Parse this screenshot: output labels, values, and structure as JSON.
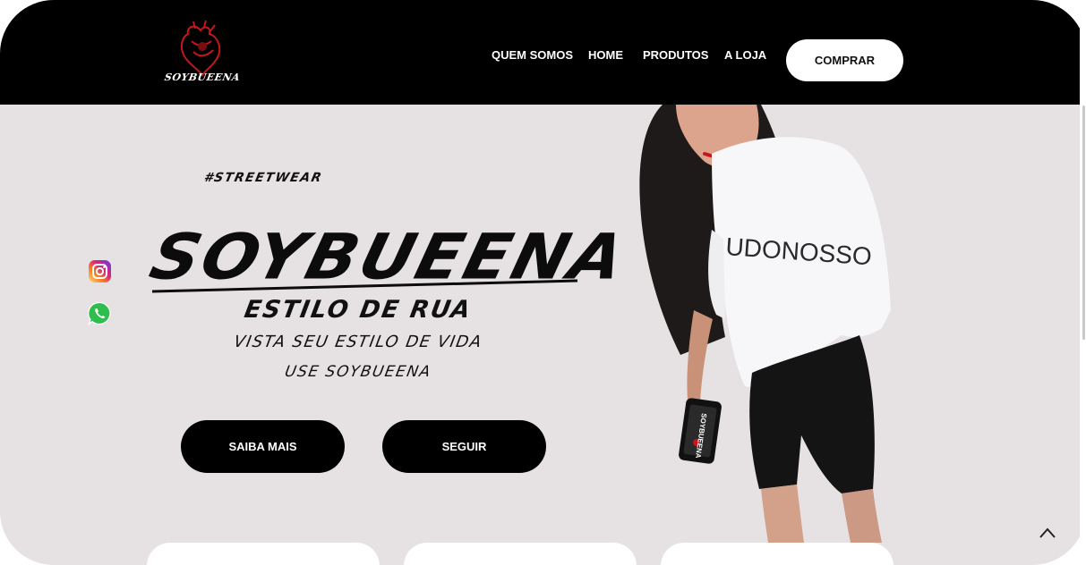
{
  "header": {
    "logo_text": "SOYBUEENA",
    "nav": [
      {
        "label": "QUEM SOMOS"
      },
      {
        "label": "HOME"
      },
      {
        "label": "PRODUTOS"
      },
      {
        "label": "A LOJA"
      }
    ],
    "buy_label": "COMPRAR"
  },
  "hero": {
    "hashtag": "#STREETWEAR",
    "brand": "SOYBUEENA",
    "tagline_1": "ESTILO DE RUA",
    "tagline_2": "VISTA SEU ESTILO DE VIDA",
    "tagline_3": "USE SOYBUEENA",
    "shirt_text": "UDONOSSO",
    "phone_text": "SOYBUEENA",
    "buttons": {
      "learn_more": "SAIBA MAIS",
      "follow": "SEGUIR"
    }
  },
  "social": {
    "instagram": "instagram-icon",
    "whatsapp": "whatsapp-icon"
  },
  "colors": {
    "header_bg": "#000000",
    "hero_bg": "#e6e1e2",
    "button_bg": "#000000",
    "accent_red": "#c4161c"
  }
}
